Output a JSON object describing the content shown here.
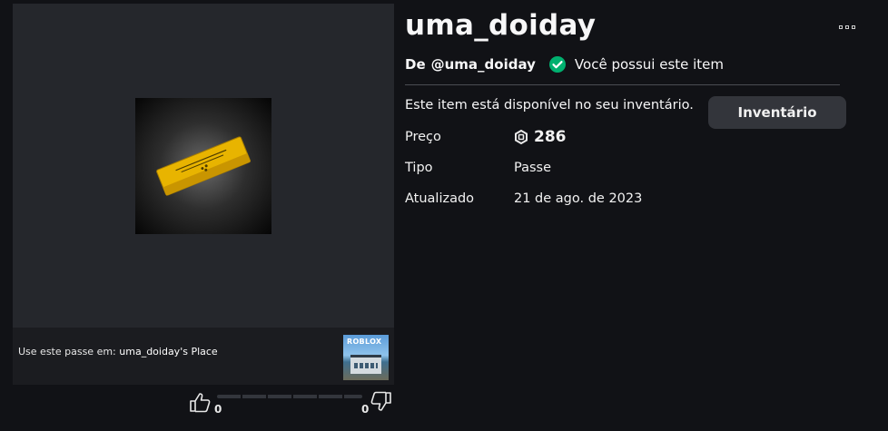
{
  "item": {
    "title": "uma_doiday",
    "by_label": "De",
    "creator": "@uma_doiday",
    "owned_text": "Você possui este item",
    "availability_text": "Este item está disponível no seu inventário.",
    "inventory_button": "Inventário",
    "details": {
      "price_label": "Preço",
      "price_value": "286",
      "type_label": "Tipo",
      "type_value": "Passe",
      "updated_label": "Atualizado",
      "updated_value": "21 de ago. de 2023"
    }
  },
  "place": {
    "prefix": "Use este passe em:",
    "name": "uma_doiday's Place",
    "thumb_logo": "ROBLOX"
  },
  "votes": {
    "up": "0",
    "down": "0"
  },
  "colors": {
    "background": "#111216",
    "card": "#25272c",
    "owned_check": "#00b06f",
    "button": "#33353b"
  },
  "icons": [
    "ticket-icon",
    "check-circle-icon",
    "robux-icon",
    "thumb-up-icon",
    "thumb-down-icon",
    "more-icon"
  ]
}
